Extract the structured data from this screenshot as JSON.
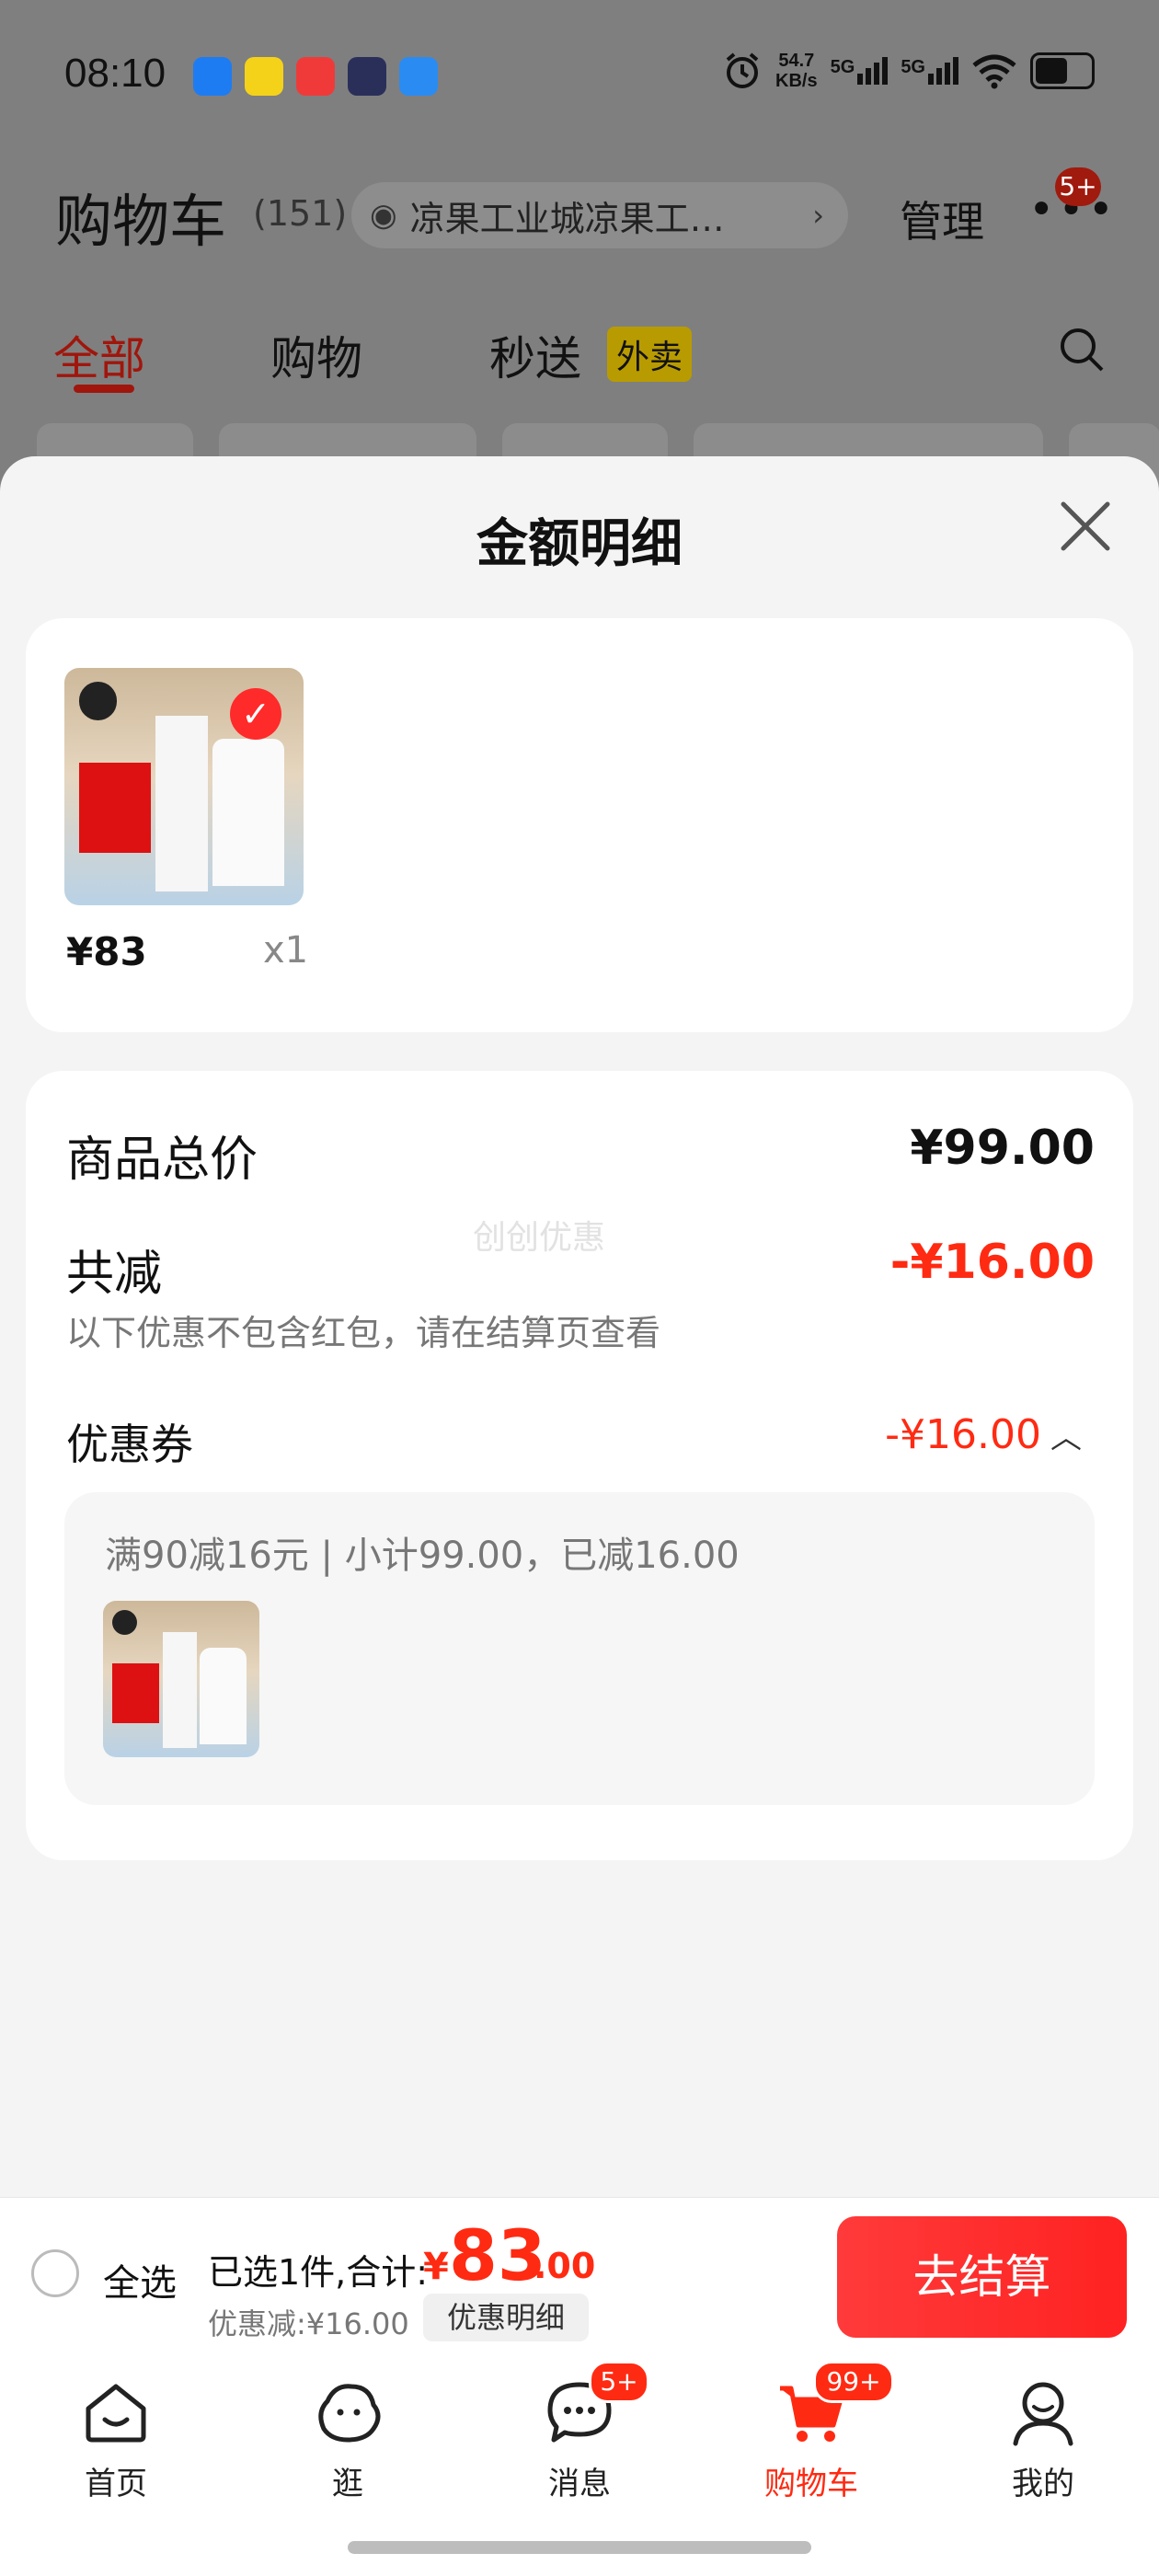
{
  "status_bar": {
    "time": "08:10",
    "net_speed_value": "54.7",
    "net_speed_unit": "KB/s",
    "signal1": "5G",
    "signal2": "5G",
    "app_icon_colors": [
      "#1e7cf2",
      "#f5d21a",
      "#f03a3a",
      "#2a2f5a",
      "#2a8cf2"
    ]
  },
  "header": {
    "title": "购物车",
    "count": "(151)",
    "location": "凉果工业城凉果工…",
    "manage": "管理",
    "more_badge": "5+"
  },
  "tabs": {
    "all": "全部",
    "shopping": "购物",
    "instant": "秒送",
    "takeaway_tag": "外卖"
  },
  "sheet": {
    "title": "金额明细",
    "product": {
      "price": "¥83",
      "quantity": "x1"
    },
    "summary": {
      "total_label": "商品总价",
      "total_value": "¥99.00",
      "reduce_label": "共减",
      "reduce_value": "-¥16.00",
      "note": "以下优惠不包含红包，请在结算页查看",
      "watermark": "创创优惠"
    },
    "coupon": {
      "label": "优惠券",
      "value": "-¥16.00",
      "caret": "︿",
      "detail": "满90减16元 | 小计99.00，已减16.00"
    }
  },
  "checkout": {
    "select_all": "全选",
    "selected_text": "已选1件,合计:",
    "total_currency": "¥",
    "total_integer": "83",
    "total_decimal": ".00",
    "discount_text": "优惠减:¥16.00",
    "detail_button": "优惠明细",
    "checkout_button": "去结算"
  },
  "tabbar": {
    "home": "首页",
    "browse": "逛",
    "messages": "消息",
    "messages_badge": "5+",
    "cart": "购物车",
    "cart_badge": "99+",
    "mine": "我的"
  },
  "colors": {
    "accent_red": "#ff2a12",
    "overlay": "#7f7f7f"
  }
}
